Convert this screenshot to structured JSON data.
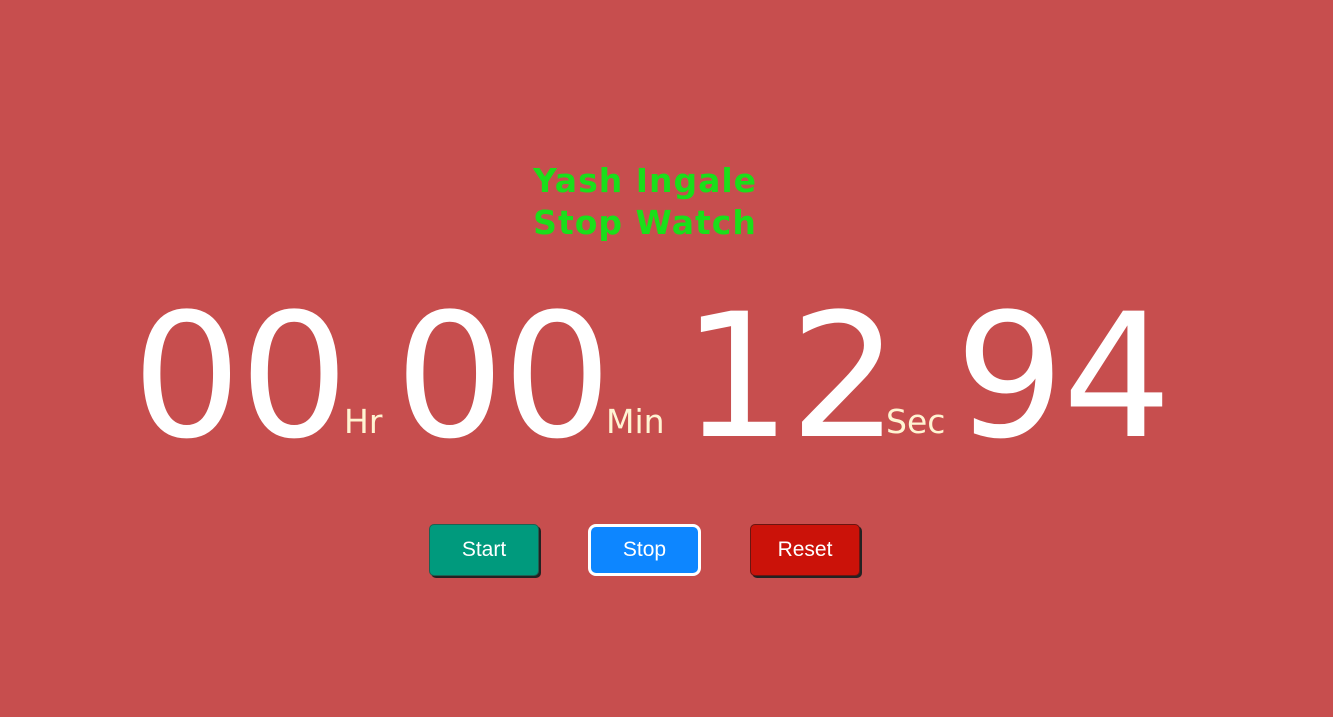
{
  "header": {
    "line1": "Yash Ingale",
    "line2": "Stop Watch"
  },
  "timer": {
    "hours": "00",
    "hours_unit": "Hr",
    "minutes": "00",
    "minutes_unit": "Min",
    "seconds": "12",
    "seconds_unit": "Sec",
    "centiseconds": "94"
  },
  "controls": {
    "start_label": "Start",
    "stop_label": "Stop",
    "reset_label": "Reset"
  },
  "colors": {
    "background": "#c74e4e",
    "title": "#1adf1a",
    "digits": "#ffffff",
    "units": "#fff4d2",
    "start": "#009a7d",
    "stop": "#0d86ff",
    "reset": "#cb1209"
  }
}
